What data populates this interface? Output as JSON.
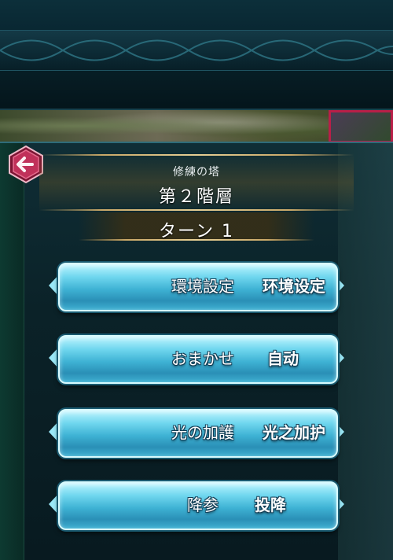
{
  "header": {
    "subtitle": "修練の塔",
    "title": "第２階層",
    "turn": "ターン 1"
  },
  "back_button": {
    "icon": "back-arrow-icon"
  },
  "menu": [
    {
      "label": "環境設定",
      "label_cn": "环境设定"
    },
    {
      "label": "おまかせ",
      "label_cn": "自动"
    },
    {
      "label": "光の加護",
      "label_cn": "光之加护"
    },
    {
      "label": "降参",
      "label_cn": "投降"
    }
  ],
  "colors": {
    "panel_bg": "#0b2228",
    "button_primary": "#3eb2d4",
    "back_button": "#c0315a",
    "gold_accent": "#c9a868"
  }
}
